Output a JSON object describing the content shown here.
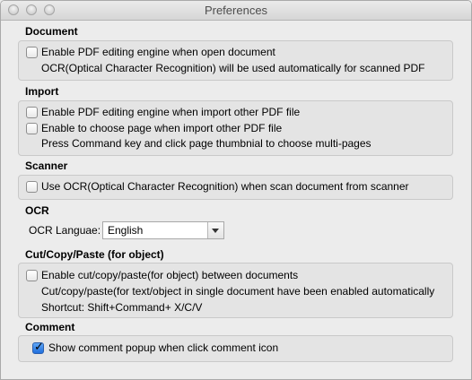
{
  "window": {
    "title": "Preferences"
  },
  "sections": {
    "document": {
      "title": "Document",
      "enable_editing": {
        "label": "Enable PDF editing  engine when open document",
        "checked": false
      },
      "note": "OCR(Optical Character Recognition) will be used automatically for scanned PDF"
    },
    "import": {
      "title": "Import",
      "enable_editing": {
        "label": "Enable PDF editing  engine when import other PDF file",
        "checked": false
      },
      "choose_page": {
        "label": "Enable to choose page when import other PDF file",
        "checked": false
      },
      "note": "Press Command key and click page thumbnial to choose multi-pages"
    },
    "scanner": {
      "title": "Scanner",
      "use_ocr": {
        "label": "Use OCR(Optical Character Recognition) when scan document from scanner",
        "checked": false
      }
    },
    "ocr": {
      "title": "OCR",
      "language_label": "OCR Languae:",
      "language_value": "English"
    },
    "cut_copy_paste": {
      "title": "Cut/Copy/Paste (for object)",
      "enable": {
        "label": "Enable cut/copy/paste(for object) between documents",
        "checked": false
      },
      "note": "Cut/copy/paste(for text/object in single document have been enabled automatically",
      "shortcut": "Shortcut: Shift+Command+ X/C/V"
    },
    "comment": {
      "title": "Comment",
      "show_popup": {
        "label": "Show comment popup when click comment icon",
        "checked": true
      }
    }
  }
}
